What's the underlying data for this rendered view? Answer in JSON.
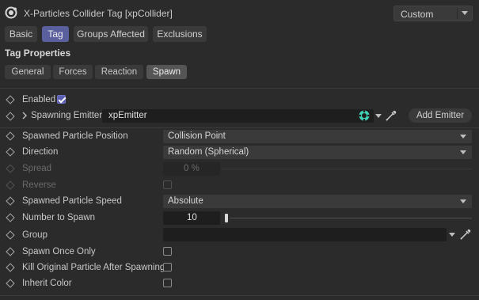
{
  "header": {
    "title": "X-Particles Collider Tag [xpCollider]",
    "preset": "Custom",
    "app_icon": "xparticles-logo-icon"
  },
  "tabs": [
    {
      "label": "Basic",
      "active": false
    },
    {
      "label": "Tag",
      "active": true
    },
    {
      "label": "Groups Affected",
      "active": false
    },
    {
      "label": "Exclusions",
      "active": false
    }
  ],
  "section": {
    "title": "Tag Properties"
  },
  "subtabs": [
    {
      "label": "General",
      "active": false
    },
    {
      "label": "Forces",
      "active": false
    },
    {
      "label": "Reaction",
      "active": false
    },
    {
      "label": "Spawn",
      "active": true
    }
  ],
  "properties": {
    "enabled": {
      "label": "Enabled",
      "checked": true
    },
    "spawning_emitter": {
      "label": "Spawning Emitter",
      "value": "xpEmitter",
      "button": "Add Emitter"
    },
    "spawned_position": {
      "label": "Spawned Particle Position",
      "value": "Collision Point"
    },
    "direction": {
      "label": "Direction",
      "value": "Random (Spherical)"
    },
    "spread": {
      "label": "Spread",
      "value": "0 %",
      "enabled": false
    },
    "reverse": {
      "label": "Reverse",
      "checked": false,
      "enabled": false
    },
    "spawned_speed": {
      "label": "Spawned Particle Speed",
      "value": "Absolute"
    },
    "number_to_spawn": {
      "label": "Number to Spawn",
      "value": "10"
    },
    "group": {
      "label": "Group",
      "value": ""
    },
    "spawn_once_only": {
      "label": "Spawn Once Only",
      "checked": false
    },
    "kill_original": {
      "label": "Kill Original Particle After Spawning",
      "checked": false
    },
    "inherit_color": {
      "label": "Inherit Color",
      "checked": false
    }
  },
  "colors": {
    "accent": "#5a5f9e",
    "background": "#2b2b2b",
    "field": "#1e1e1e"
  }
}
